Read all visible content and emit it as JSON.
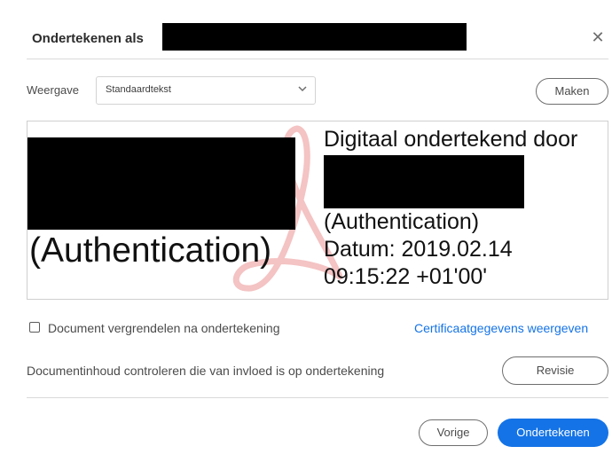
{
  "dialog": {
    "title": "Ondertekenen als",
    "close_icon": "close-icon",
    "weergave_label": "Weergave",
    "weergave_value": "Standaardtekst",
    "maken_label": "Maken",
    "preview": {
      "auth_large": "(Authentication)",
      "signed_by": "Digitaal ondertekend door",
      "auth_small": "(Authentication)",
      "datum": "Datum: 2019.02.14",
      "time": "09:15:22 +01'00'",
      "logo_icon": "acrobat-logo-watermark"
    },
    "lock_label": "Document vergrendelen na ondertekening",
    "lock_checked": false,
    "cert_link": "Certificaatgegevens weergeven",
    "review_text": "Documentinhoud controleren die van invloed is op ondertekening",
    "revisie_label": "Revisie",
    "vorige_label": "Vorige",
    "sign_label": "Ondertekenen",
    "colors": {
      "primary": "#1473e6",
      "link": "#1473e6",
      "watermark": "#f2b8b8"
    }
  }
}
